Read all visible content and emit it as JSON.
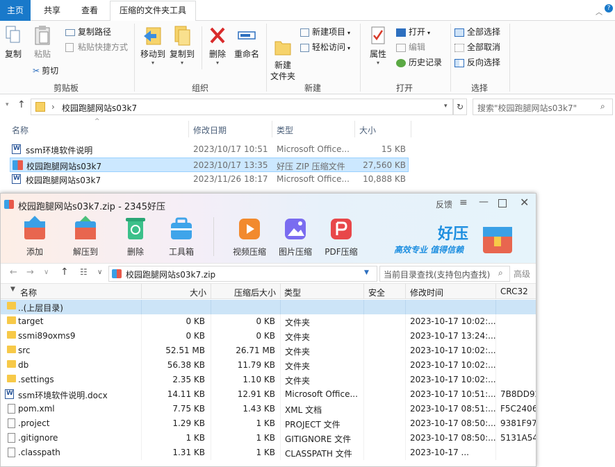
{
  "explorer": {
    "tabs": [
      "主页",
      "共享",
      "查看",
      "压缩的文件夹工具"
    ],
    "ribbon": {
      "clipboard": {
        "copy": "复制",
        "paste": "粘贴",
        "copy_path": "复制路径",
        "paste_shortcut": "粘贴快捷方式",
        "cut": "剪切",
        "label": "剪贴板"
      },
      "organize": {
        "move_to": "移动到",
        "copy_to": "复制到",
        "delete": "删除",
        "rename": "重命名",
        "label": "组织"
      },
      "new": {
        "new_folder": "新建\n文件夹",
        "new_item": "新建项目",
        "easy_access": "轻松访问",
        "label": "新建"
      },
      "open": {
        "properties": "属性",
        "open": "打开",
        "edit": "编辑",
        "history": "历史记录",
        "label": "打开"
      },
      "select": {
        "select_all": "全部选择",
        "select_none": "全部取消",
        "invert": "反向选择",
        "label": "选择"
      }
    },
    "address": {
      "path": "校园跑腿网站s03k7",
      "search_placeholder": "搜索\"校园跑腿网站s03k7\""
    },
    "columns": [
      "名称",
      "修改日期",
      "类型",
      "大小"
    ],
    "files": [
      {
        "name": "ssm环境软件说明",
        "date": "2023/10/17 10:51",
        "type": "Microsoft Office...",
        "size": "15 KB"
      },
      {
        "name": "校园跑腿网站s03k7",
        "date": "2023/10/17 13:35",
        "type": "好压 ZIP 压缩文件",
        "size": "27,560 KB"
      },
      {
        "name": "校园跑腿网站s03k7",
        "date": "2023/11/26 18:17",
        "type": "Microsoft Office...",
        "size": "10,888 KB"
      }
    ]
  },
  "haozip": {
    "title": "校园跑腿网站s03k7.zip - 2345好压",
    "title_buttons": {
      "feedback": "反馈"
    },
    "toolbar": [
      "添加",
      "解压到",
      "删除",
      "工具箱",
      "视频压缩",
      "图片压缩",
      "PDF压缩"
    ],
    "brand": {
      "name": "好压",
      "slogan": "高效专业 值得信赖"
    },
    "path": "校园跑腿网站s03k7.zip",
    "search_placeholder": "当前目录查找(支持包内查找)",
    "advanced": "高级",
    "columns": [
      "名称",
      "大小",
      "压缩后大小",
      "类型",
      "安全",
      "修改时间",
      "CRC32"
    ],
    "rows": [
      {
        "name": "..(上层目录)",
        "size": "",
        "packed": "",
        "type": "",
        "time": "",
        "crc": "",
        "icon": "folder"
      },
      {
        "name": "target",
        "size": "0 KB",
        "packed": "0 KB",
        "type": "文件夹",
        "time": "2023-10-17 10:02:...",
        "crc": "",
        "icon": "folder"
      },
      {
        "name": "ssmi89oxms9",
        "size": "0 KB",
        "packed": "0 KB",
        "type": "文件夹",
        "time": "2023-10-17 13:24:...",
        "crc": "",
        "icon": "folder"
      },
      {
        "name": "src",
        "size": "52.51 MB",
        "packed": "26.71 MB",
        "type": "文件夹",
        "time": "2023-10-17 10:02:...",
        "crc": "",
        "icon": "folder"
      },
      {
        "name": "db",
        "size": "56.38 KB",
        "packed": "11.79 KB",
        "type": "文件夹",
        "time": "2023-10-17 10:02:...",
        "crc": "",
        "icon": "folder"
      },
      {
        "name": ".settings",
        "size": "2.35 KB",
        "packed": "1.10 KB",
        "type": "文件夹",
        "time": "2023-10-17 10:02:...",
        "crc": "",
        "icon": "folder"
      },
      {
        "name": "ssm环境软件说明.docx",
        "size": "14.11 KB",
        "packed": "12.91 KB",
        "type": "Microsoft Office...",
        "time": "2023-10-17 10:51:...",
        "crc": "7B8DD92",
        "icon": "word"
      },
      {
        "name": "pom.xml",
        "size": "7.75 KB",
        "packed": "1.43 KB",
        "type": "XML 文档",
        "time": "2023-10-17 08:51:...",
        "crc": "F5C2406",
        "icon": "file"
      },
      {
        "name": ".project",
        "size": "1.29 KB",
        "packed": "1 KB",
        "type": "PROJECT 文件",
        "time": "2023-10-17 08:50:...",
        "crc": "9381F978",
        "icon": "file"
      },
      {
        "name": ".gitignore",
        "size": "1 KB",
        "packed": "1 KB",
        "type": "GITIGNORE 文件",
        "time": "2023-10-17 08:50:...",
        "crc": "5131A54",
        "icon": "file"
      },
      {
        "name": ".classpath",
        "size": "1.31 KB",
        "packed": "1 KB",
        "type": "CLASSPATH 文件",
        "time": "2023-10-17 ...",
        "crc": "",
        "icon": "file"
      }
    ]
  }
}
